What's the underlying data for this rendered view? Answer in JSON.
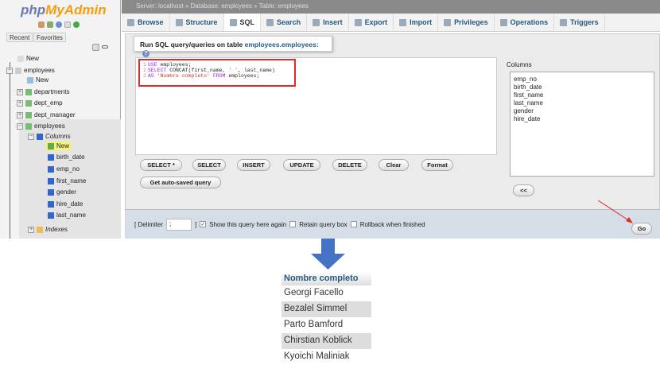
{
  "sidebar": {
    "logo_php": "php",
    "logo_myadmin": "MyAdmin",
    "tabs": [
      "Recent",
      "Favorites"
    ],
    "tree": [
      {
        "label": "New"
      },
      {
        "label": "employees"
      },
      {
        "label": "New"
      },
      {
        "label": "departments"
      },
      {
        "label": "dept_emp"
      },
      {
        "label": "dept_manager"
      },
      {
        "label": "employees"
      },
      {
        "label": "Columns"
      },
      {
        "label": "New"
      },
      {
        "label": "birth_date"
      },
      {
        "label": "emp_no"
      },
      {
        "label": "first_name"
      },
      {
        "label": "gender"
      },
      {
        "label": "hire_date"
      },
      {
        "label": "last_name"
      },
      {
        "label": "Indexes"
      }
    ]
  },
  "breadcrumb": {
    "server": "Server: localhost",
    "database": "Database: employees",
    "table": "Table: employees",
    "sep": "»"
  },
  "tabs": [
    "Browse",
    "Structure",
    "SQL",
    "Search",
    "Insert",
    "Export",
    "Import",
    "Privileges",
    "Operations",
    "Triggers"
  ],
  "panel": {
    "legend_prefix": "Run SQL query/queries on table ",
    "legend_table": "employees.employees:",
    "code": {
      "l1_kw": "USE",
      "l1_rest": " employees;",
      "l2_kw": "SELECT",
      "l2_rest": " CONCAT(first_name, ",
      "l2_str": "' '",
      "l2_end": ", last_name)",
      "l3_kw": "AS",
      "l3_str": " 'Nombre completo'",
      "l3_kw2": " FROM",
      "l3_rest": " employees;"
    },
    "buttons": [
      "SELECT *",
      "SELECT",
      "INSERT",
      "UPDATE",
      "DELETE",
      "Clear",
      "Format"
    ],
    "autosave": "Get auto-saved query",
    "columns_label": "Columns",
    "columns": [
      "emp_no",
      "birth_date",
      "first_name",
      "last_name",
      "gender",
      "hire_date"
    ],
    "insert_btn": "<<"
  },
  "bottom": {
    "delim_label": "[ Delimiter",
    "delim_value": ";",
    "close": "]",
    "show_again": "Show this query here again",
    "retain": "Retain query box",
    "rollback": "Rollback when finished",
    "go": "Go"
  },
  "result": {
    "header": "Nombre completo",
    "rows": [
      "Georgi Facello",
      "Bezalel Simmel",
      "Parto Bamford",
      "Chirstian Koblick",
      "Kyoichi Maliniak"
    ]
  },
  "colors": {
    "accent": "#235a81",
    "highlight": "#e02a2a",
    "arrow": "#4472c4"
  }
}
